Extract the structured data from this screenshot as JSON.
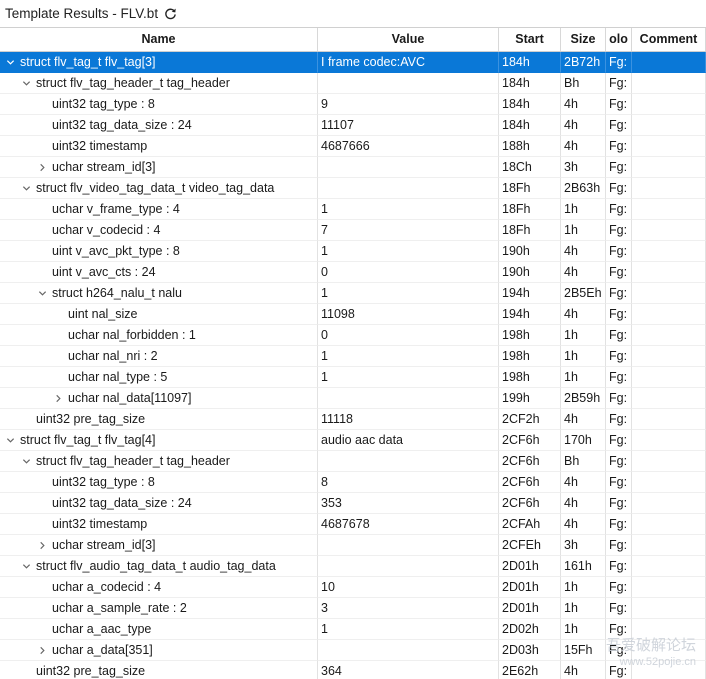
{
  "window": {
    "title": "Template Results - FLV.bt",
    "refresh_icon": "refresh-icon"
  },
  "columns": [
    "Name",
    "Value",
    "Start",
    "Size",
    "olo",
    "Comment"
  ],
  "rows": [
    {
      "name": "struct flv_tag_t flv_tag[3]",
      "value": "I frame codec:AVC",
      "start": "184h",
      "size": "2B72h",
      "color": "Fg:",
      "comment": "",
      "level": 0,
      "toggle": "expanded",
      "selected": true
    },
    {
      "name": "struct flv_tag_header_t tag_header",
      "value": "",
      "start": "184h",
      "size": "Bh",
      "color": "Fg:",
      "comment": "",
      "level": 1,
      "toggle": "expanded"
    },
    {
      "name": "uint32 tag_type : 8",
      "value": "9",
      "start": "184h",
      "size": "4h",
      "color": "Fg:",
      "comment": "",
      "level": 2,
      "toggle": "leaf"
    },
    {
      "name": "uint32 tag_data_size : 24",
      "value": "11107",
      "start": "184h",
      "size": "4h",
      "color": "Fg:",
      "comment": "",
      "level": 2,
      "toggle": "leaf"
    },
    {
      "name": "uint32 timestamp",
      "value": "4687666",
      "start": "188h",
      "size": "4h",
      "color": "Fg:",
      "comment": "",
      "level": 2,
      "toggle": "leaf"
    },
    {
      "name": "uchar stream_id[3]",
      "value": "",
      "start": "18Ch",
      "size": "3h",
      "color": "Fg:",
      "comment": "",
      "level": 2,
      "toggle": "collapsed"
    },
    {
      "name": "struct flv_video_tag_data_t video_tag_data",
      "value": "",
      "start": "18Fh",
      "size": "2B63h",
      "color": "Fg:",
      "comment": "",
      "level": 1,
      "toggle": "expanded"
    },
    {
      "name": "uchar v_frame_type : 4",
      "value": "1",
      "start": "18Fh",
      "size": "1h",
      "color": "Fg:",
      "comment": "",
      "level": 2,
      "toggle": "leaf"
    },
    {
      "name": "uchar v_codecid : 4",
      "value": "7",
      "start": "18Fh",
      "size": "1h",
      "color": "Fg:",
      "comment": "",
      "level": 2,
      "toggle": "leaf"
    },
    {
      "name": "uint v_avc_pkt_type : 8",
      "value": "1",
      "start": "190h",
      "size": "4h",
      "color": "Fg:",
      "comment": "",
      "level": 2,
      "toggle": "leaf"
    },
    {
      "name": "uint v_avc_cts : 24",
      "value": "0",
      "start": "190h",
      "size": "4h",
      "color": "Fg:",
      "comment": "",
      "level": 2,
      "toggle": "leaf"
    },
    {
      "name": "struct h264_nalu_t nalu",
      "value": "1",
      "start": "194h",
      "size": "2B5Eh",
      "color": "Fg:",
      "comment": "",
      "level": 2,
      "toggle": "expanded"
    },
    {
      "name": "uint nal_size",
      "value": "11098",
      "start": "194h",
      "size": "4h",
      "color": "Fg:",
      "comment": "",
      "level": 3,
      "toggle": "leaf"
    },
    {
      "name": "uchar nal_forbidden : 1",
      "value": "0",
      "start": "198h",
      "size": "1h",
      "color": "Fg:",
      "comment": "",
      "level": 3,
      "toggle": "leaf"
    },
    {
      "name": "uchar nal_nri : 2",
      "value": "1",
      "start": "198h",
      "size": "1h",
      "color": "Fg:",
      "comment": "",
      "level": 3,
      "toggle": "leaf"
    },
    {
      "name": "uchar nal_type : 5",
      "value": "1",
      "start": "198h",
      "size": "1h",
      "color": "Fg:",
      "comment": "",
      "level": 3,
      "toggle": "leaf"
    },
    {
      "name": "uchar nal_data[11097]",
      "value": "",
      "start": "199h",
      "size": "2B59h",
      "color": "Fg:",
      "comment": "",
      "level": 3,
      "toggle": "collapsed"
    },
    {
      "name": "uint32 pre_tag_size",
      "value": "11118",
      "start": "2CF2h",
      "size": "4h",
      "color": "Fg:",
      "comment": "",
      "level": 1,
      "toggle": "leaf"
    },
    {
      "name": "struct flv_tag_t flv_tag[4]",
      "value": "audio aac data",
      "start": "2CF6h",
      "size": "170h",
      "color": "Fg:",
      "comment": "",
      "level": 0,
      "toggle": "expanded"
    },
    {
      "name": "struct flv_tag_header_t tag_header",
      "value": "",
      "start": "2CF6h",
      "size": "Bh",
      "color": "Fg:",
      "comment": "",
      "level": 1,
      "toggle": "expanded"
    },
    {
      "name": "uint32 tag_type : 8",
      "value": "8",
      "start": "2CF6h",
      "size": "4h",
      "color": "Fg:",
      "comment": "",
      "level": 2,
      "toggle": "leaf"
    },
    {
      "name": "uint32 tag_data_size : 24",
      "value": "353",
      "start": "2CF6h",
      "size": "4h",
      "color": "Fg:",
      "comment": "",
      "level": 2,
      "toggle": "leaf"
    },
    {
      "name": "uint32 timestamp",
      "value": "4687678",
      "start": "2CFAh",
      "size": "4h",
      "color": "Fg:",
      "comment": "",
      "level": 2,
      "toggle": "leaf"
    },
    {
      "name": "uchar stream_id[3]",
      "value": "",
      "start": "2CFEh",
      "size": "3h",
      "color": "Fg:",
      "comment": "",
      "level": 2,
      "toggle": "collapsed"
    },
    {
      "name": "struct flv_audio_tag_data_t audio_tag_data",
      "value": "",
      "start": "2D01h",
      "size": "161h",
      "color": "Fg:",
      "comment": "",
      "level": 1,
      "toggle": "expanded"
    },
    {
      "name": "uchar a_codecid : 4",
      "value": "10",
      "start": "2D01h",
      "size": "1h",
      "color": "Fg:",
      "comment": "",
      "level": 2,
      "toggle": "leaf"
    },
    {
      "name": "uchar a_sample_rate : 2",
      "value": "3",
      "start": "2D01h",
      "size": "1h",
      "color": "Fg:",
      "comment": "",
      "level": 2,
      "toggle": "leaf"
    },
    {
      "name": "uchar a_aac_type",
      "value": "1",
      "start": "2D02h",
      "size": "1h",
      "color": "Fg:",
      "comment": "",
      "level": 2,
      "toggle": "leaf"
    },
    {
      "name": "uchar a_data[351]",
      "value": "",
      "start": "2D03h",
      "size": "15Fh",
      "color": "Fg:",
      "comment": "",
      "level": 2,
      "toggle": "collapsed"
    },
    {
      "name": "uint32 pre_tag_size",
      "value": "364",
      "start": "2E62h",
      "size": "4h",
      "color": "Fg:",
      "comment": "",
      "level": 1,
      "toggle": "leaf"
    }
  ],
  "watermark": {
    "line1": "吾爱破解论坛",
    "line2": "www.52pojie.cn"
  },
  "colors": {
    "selection": "#0a78d7",
    "header_bg": "#ffffff",
    "grid_line": "#e2e2e2"
  }
}
